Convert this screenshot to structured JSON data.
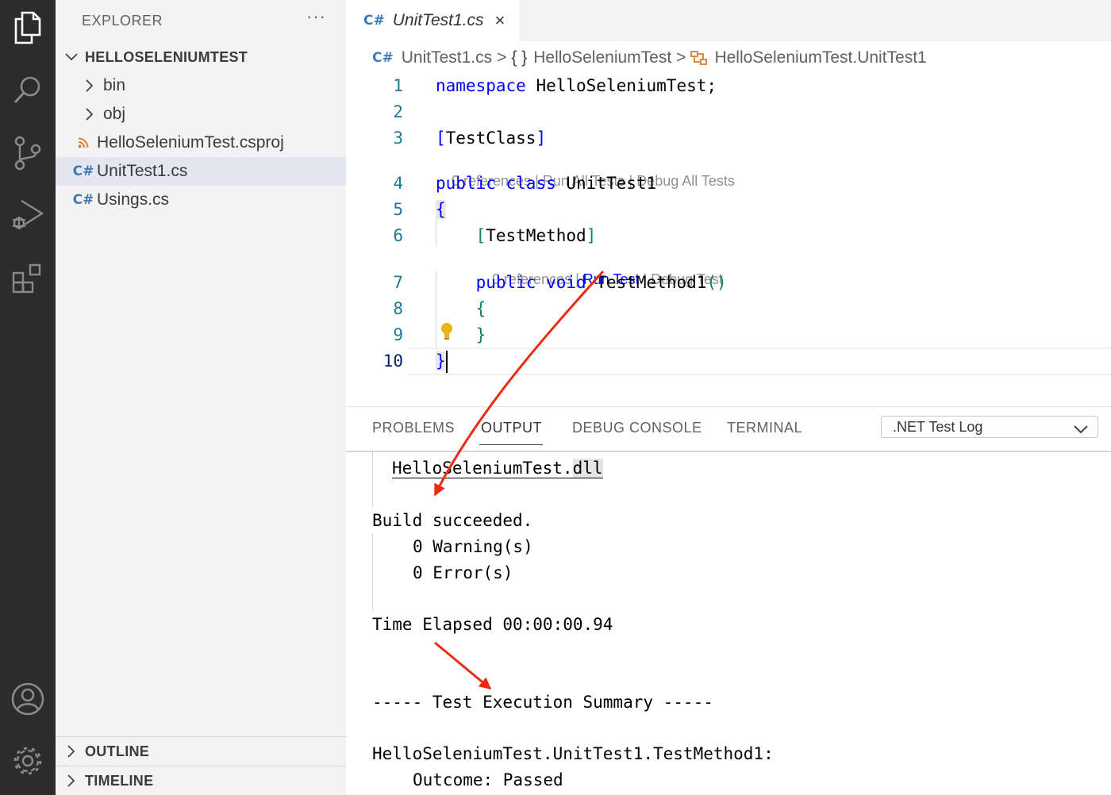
{
  "activity_bar": {
    "items": [
      {
        "name": "explorer-icon"
      },
      {
        "name": "search-icon"
      },
      {
        "name": "source-control-icon"
      },
      {
        "name": "run-debug-icon"
      },
      {
        "name": "extensions-icon"
      },
      {
        "name": "accounts-icon"
      },
      {
        "name": "settings-gear-icon"
      }
    ]
  },
  "sidebar": {
    "title": "EXPLORER",
    "more": "···",
    "project": "HELLOSELENIUMTEST",
    "items": [
      {
        "label": "bin",
        "icon": "chevron-right-icon"
      },
      {
        "label": "obj",
        "icon": "chevron-right-icon"
      },
      {
        "label": "HelloSeleniumTest.csproj",
        "icon": "rss-icon"
      },
      {
        "label": "UnitTest1.cs",
        "icon": "csharp-icon",
        "selected": true
      },
      {
        "label": "Usings.cs",
        "icon": "csharp-icon"
      }
    ],
    "outline": "OUTLINE",
    "timeline": "TIMELINE"
  },
  "editor": {
    "tab": {
      "label": "UnitTest1.cs",
      "close": "×"
    },
    "csharp_glyph": "C#",
    "breadcrumb": {
      "file": "UnitTest1.cs",
      "sep": ">",
      "ns_icon": "{ }",
      "namespace": "HelloSeleniumTest",
      "class": "HelloSeleniumTest.UnitTest1"
    },
    "line_numbers": [
      "1",
      "2",
      "3",
      "4",
      "5",
      "6",
      "7",
      "8",
      "9",
      "10"
    ],
    "code": {
      "l1_kw": "namespace",
      "l1_rest": " HelloSeleniumTest;",
      "l3_open": "[",
      "l3_text": "TestClass",
      "l3_close": "]",
      "l4_kw1": "public",
      "l4_kw2": "class",
      "l4_name": " UnitTest1",
      "l5": "{",
      "l6_open": "[",
      "l6_text": "TestMethod",
      "l6_close": "]",
      "l7_kw1": "public",
      "l7_kw2": "void",
      "l7_name": " TestMethod1",
      "l7_parens": "()",
      "l8": "{",
      "l9": "}",
      "l10": "}"
    },
    "lens_class": {
      "refs": "0 references",
      "sep": " | ",
      "run": "Run All Tests",
      "debug": "Debug All Tests"
    },
    "lens_method": {
      "refs": "0 references",
      "sep": " | ",
      "run": "Run Test",
      "debug": "Debug Test"
    }
  },
  "panel": {
    "tabs": [
      "PROBLEMS",
      "OUTPUT",
      "DEBUG CONSOLE",
      "TERMINAL"
    ],
    "active_tab": "OUTPUT",
    "dropdown": ".NET Test Log",
    "output": {
      "dll_name": "HelloSeleniumTest.",
      "dll_ext": "dll",
      "build": "Build succeeded.",
      "warnings": "0 Warning(s)",
      "errors": "0 Error(s)",
      "elapsed": "Time Elapsed 00:00:00.94",
      "summary": "----- Test Execution Summary -----",
      "test_name": "HelloSeleniumTest.UnitTest1.TestMethod1:",
      "outcome": "Outcome: Passed"
    }
  },
  "colors": {
    "annotation_arrow": "#ee2a12",
    "keyword": "#0000ff",
    "bracket": "#098658",
    "activity_bg": "#2c2c2c"
  }
}
